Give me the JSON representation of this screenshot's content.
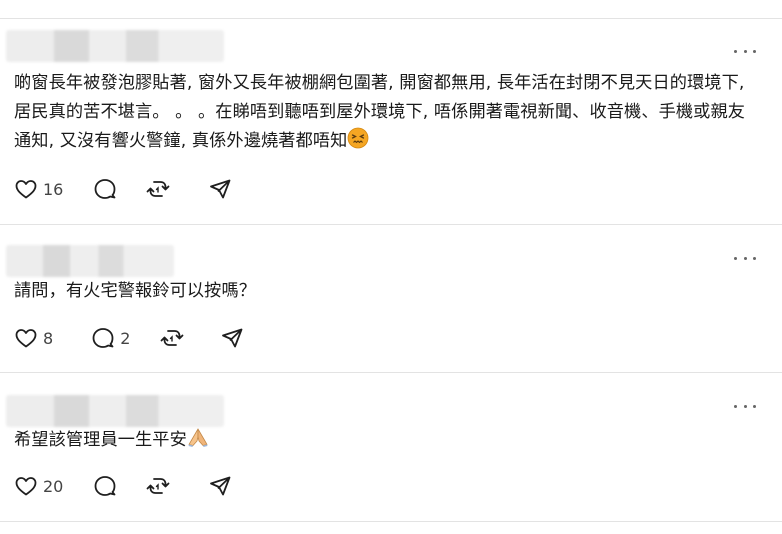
{
  "comments": [
    {
      "text": "啲窗長年被發泡膠貼著, 窗外又長年被棚網包圍著, 開窗都無用, 長年活在封閉不見天日的環境下, 居民真的苦不堪言。 。 。在睇唔到聽唔到屋外環境下, 唔係開著電視新聞、收音機、手機或親友通知, 又沒有響火警鐘, 真係外邊燒著都唔知",
      "emoji": "confounded-face",
      "likes": "16",
      "replies": "",
      "icons": [
        "heart-icon",
        "comment-icon",
        "repost-icon",
        "share-icon"
      ]
    },
    {
      "text": "請問，有火宅警報鈴可以按嗎？",
      "emoji": "",
      "likes": "8",
      "replies": "2",
      "icons": [
        "heart-icon",
        "comment-icon",
        "repost-icon",
        "share-icon"
      ]
    },
    {
      "text": "希望該管理員一生平安",
      "emoji": "folded-hands",
      "likes": "20",
      "replies": "",
      "icons": [
        "heart-icon",
        "comment-icon",
        "repost-icon",
        "share-icon"
      ]
    }
  ],
  "colors": {
    "icon": "#1f1f1f",
    "divider": "#e3e3e3",
    "count": "#444444"
  }
}
